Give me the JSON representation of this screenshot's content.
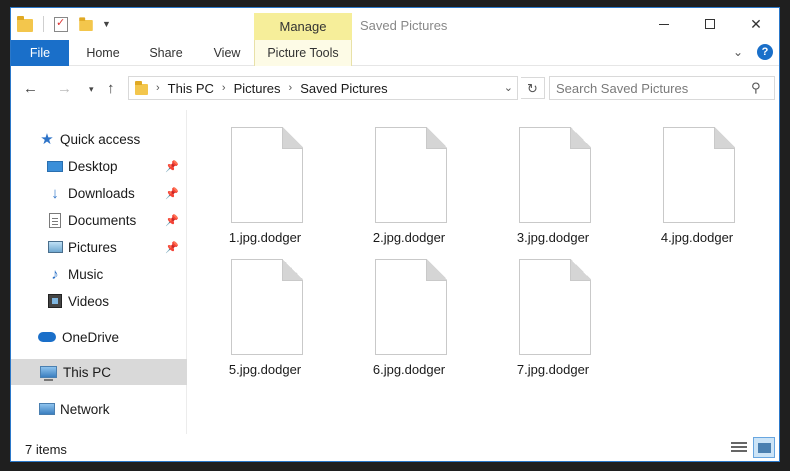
{
  "window": {
    "title": "Saved Pictures",
    "manage_tab": "Manage",
    "controls": {
      "minimize": "minimize",
      "maximize": "maximize",
      "close": "✕"
    }
  },
  "ribbon": {
    "tabs": [
      {
        "label": "File"
      },
      {
        "label": "Home"
      },
      {
        "label": "Share"
      },
      {
        "label": "View"
      },
      {
        "label": "Picture Tools"
      }
    ],
    "help_label": "?"
  },
  "address": {
    "breadcrumbs": [
      "This PC",
      "Pictures",
      "Saved Pictures"
    ],
    "search_placeholder": "Search Saved Pictures"
  },
  "navpane": {
    "items": [
      {
        "label": "Quick access",
        "icon": "star-icon"
      },
      {
        "label": "Desktop",
        "icon": "desktop-icon",
        "pinned": true
      },
      {
        "label": "Downloads",
        "icon": "download-icon",
        "pinned": true
      },
      {
        "label": "Documents",
        "icon": "document-icon",
        "pinned": true
      },
      {
        "label": "Pictures",
        "icon": "pictures-icon",
        "pinned": true
      },
      {
        "label": "Music",
        "icon": "music-icon"
      },
      {
        "label": "Videos",
        "icon": "videos-icon"
      },
      {
        "label": "OneDrive",
        "icon": "cloud-icon"
      },
      {
        "label": "This PC",
        "icon": "computer-icon",
        "selected": true
      },
      {
        "label": "Network",
        "icon": "network-icon"
      }
    ]
  },
  "files": [
    {
      "name": "1.jpg.dodger"
    },
    {
      "name": "2.jpg.dodger"
    },
    {
      "name": "3.jpg.dodger"
    },
    {
      "name": "4.jpg.dodger"
    },
    {
      "name": "5.jpg.dodger"
    },
    {
      "name": "6.jpg.dodger"
    },
    {
      "name": "7.jpg.dodger"
    }
  ],
  "status": {
    "item_count": "7 items"
  },
  "colors": {
    "accent": "#1a6fc9",
    "manage_highlight": "#f6ee9a",
    "selection": "#d9d9d9"
  }
}
